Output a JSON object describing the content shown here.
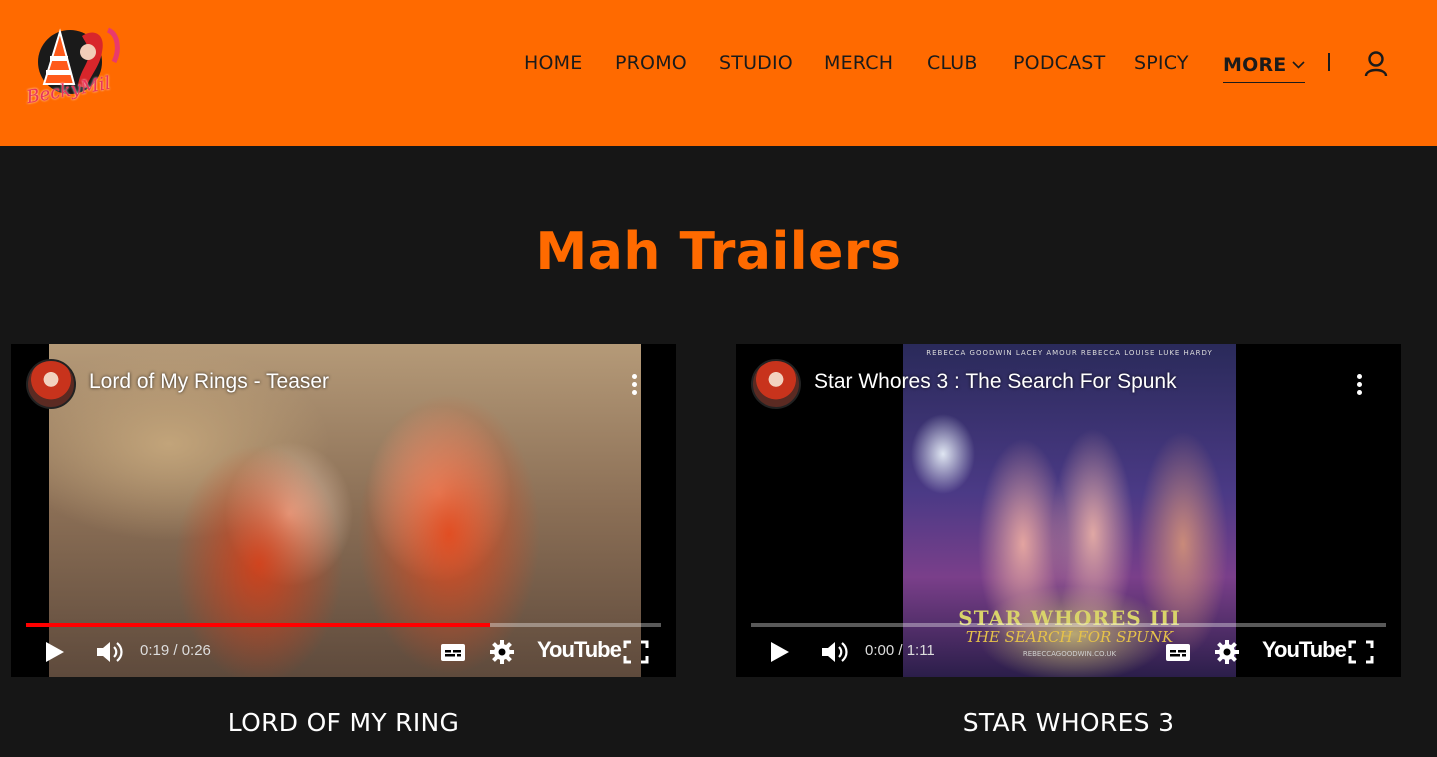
{
  "header": {
    "background": "#ff6a00",
    "logo_text": "BeckyMil",
    "nav": [
      {
        "label": "HOME",
        "name": "nav-home"
      },
      {
        "label": "PROMO",
        "name": "nav-promo"
      },
      {
        "label": "STUDIO",
        "name": "nav-studio"
      },
      {
        "label": "MERCH",
        "name": "nav-merch"
      },
      {
        "label": "CLUB",
        "name": "nav-club"
      },
      {
        "label": "PODCAST",
        "name": "nav-podcast"
      },
      {
        "label": "SPICY",
        "name": "nav-spicy"
      }
    ],
    "more_label": "MORE",
    "account_icon": "user-icon"
  },
  "section": {
    "title": "Mah Trailers",
    "accent": "#ff6a00"
  },
  "videos": [
    {
      "title": "Lord of My Rings - Teaser",
      "time": "0:19 / 0:26",
      "progress": 0.73,
      "brand": "YouTube",
      "caption": "LORD OF MY RING"
    },
    {
      "title": "Star Whores 3 : The Search For Spunk",
      "time": "0:00 / 1:11",
      "progress": 0.0,
      "brand": "YouTube",
      "caption": "STAR WHORES 3",
      "poster": {
        "cast": "REBECCA GOODWIN   LACEY AMOUR   REBECCA LOUISE   LUKE HARDY",
        "title": "STAR WHORES III",
        "subtitle": "THE SEARCH FOR SPUNK",
        "url": "REBECCAGOODWIN.CO.UK"
      }
    }
  ]
}
